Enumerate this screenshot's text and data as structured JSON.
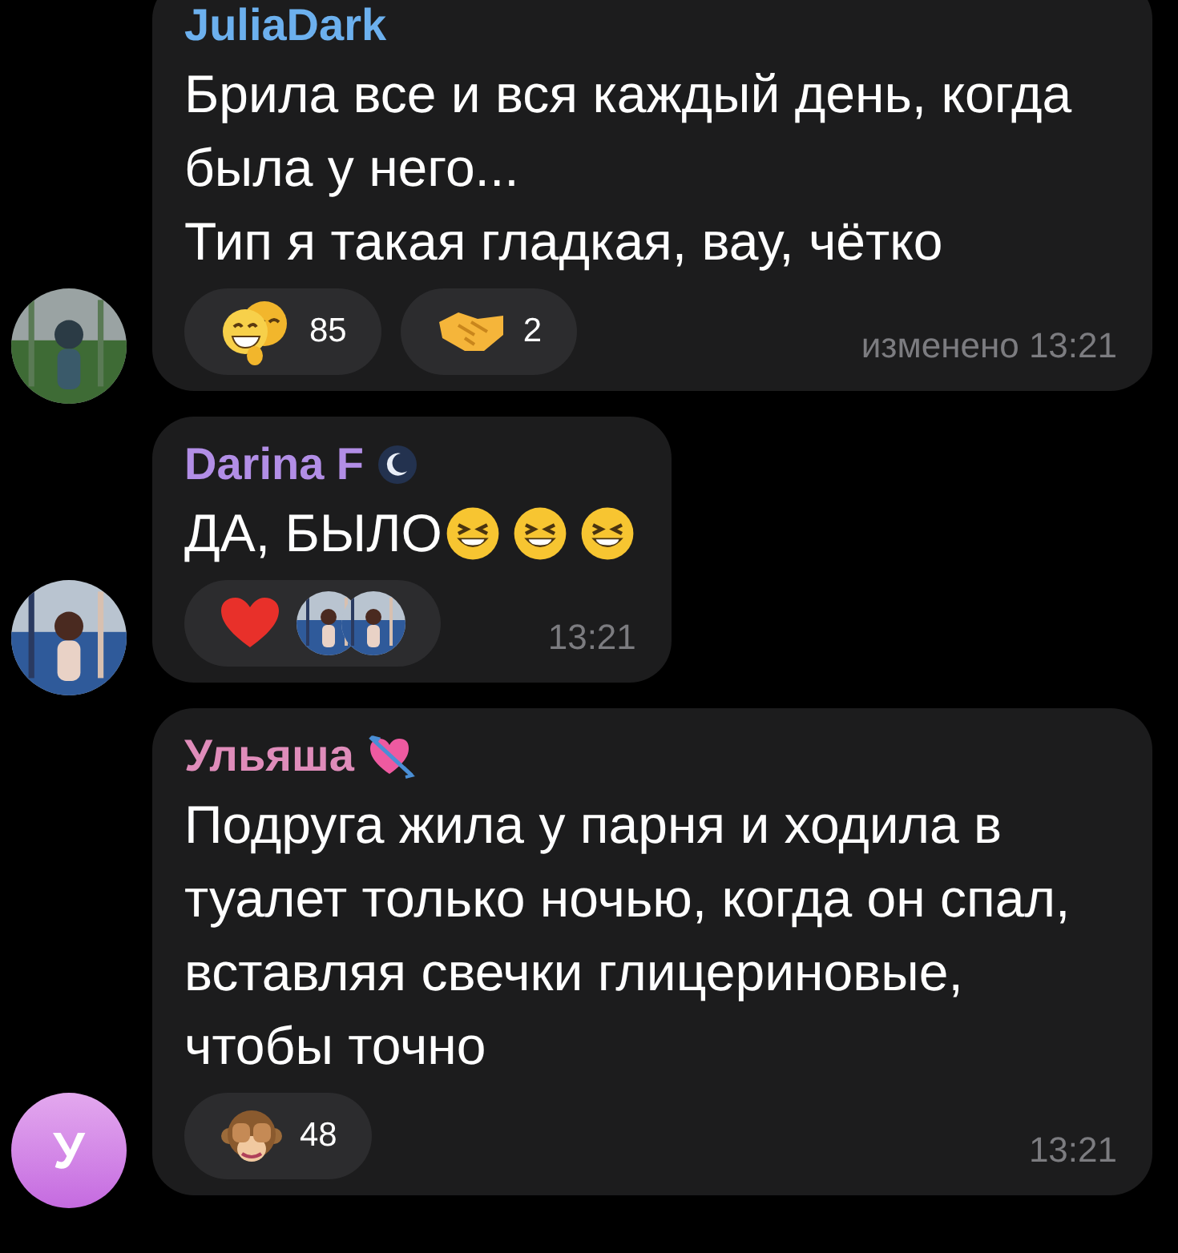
{
  "messages": [
    {
      "author": "JuliaDark",
      "color": "#6cb0ee",
      "badge": {
        "kind": "none"
      },
      "avatar": {
        "kind": "picture"
      },
      "text": "Брила все и вся каждый день, когда была у него...\nТип я такая гладкая, вау, чётко",
      "reactions": [
        {
          "kind": "faces",
          "count": "85"
        },
        {
          "kind": "handshake",
          "count": "2"
        }
      ],
      "time": "изменено 13:21"
    },
    {
      "author": "Darina F",
      "color": "#b28ee6",
      "badge": {
        "kind": "moon"
      },
      "avatar": {
        "kind": "picture"
      },
      "text": "ДА, БЫЛО",
      "reactions": [
        {
          "kind": "heart",
          "reactors": [
            {
              "kind": "picture"
            },
            {
              "kind": "picture"
            }
          ]
        }
      ],
      "time": "13:21"
    },
    {
      "author": "Ульяша",
      "color": "#df8cba",
      "badge": {
        "kind": "heart-arrow"
      },
      "avatar": {
        "kind": "letter",
        "letter": "У"
      },
      "text": "Подруга жила у парня и ходила в туалет только ночью, когда он спал, вставляя свечки глицериновые, чтобы точно",
      "reactions": [
        {
          "kind": "monkey",
          "count": "48"
        }
      ],
      "time": "13:21"
    }
  ]
}
